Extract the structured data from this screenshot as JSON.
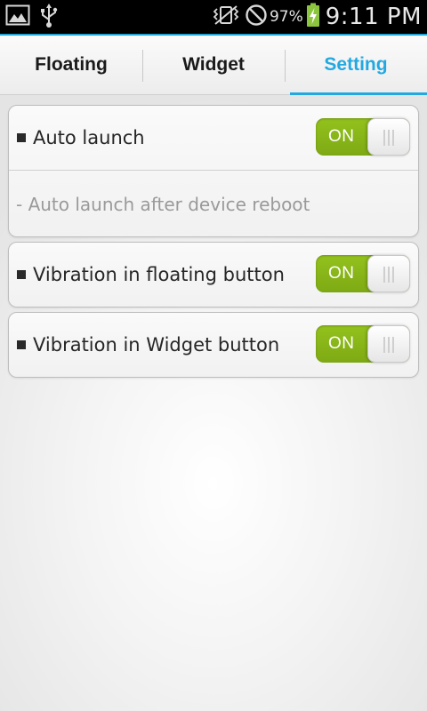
{
  "status_bar": {
    "left_icons": [
      "gallery-icon",
      "usb-icon"
    ],
    "right_icons": [
      "vibrate-icon",
      "blocked-icon",
      "battery-charging-icon"
    ],
    "battery_percent": "97%",
    "time": "9:11 PM"
  },
  "tabs": [
    {
      "label": "Floating",
      "active": false
    },
    {
      "label": "Widget",
      "active": false
    },
    {
      "label": "Setting",
      "active": true
    }
  ],
  "settings": {
    "auto_launch": {
      "label": "Auto launch",
      "description": "- Auto launch after device reboot",
      "toggle": "ON"
    },
    "vibration_floating": {
      "label": "Vibration in floating button",
      "toggle": "ON"
    },
    "vibration_widget": {
      "label": "Vibration in Widget button",
      "toggle": "ON"
    }
  },
  "colors": {
    "accent": "#23a9e0",
    "toggle_on": "#8cba1a",
    "status_bar": "#000000"
  }
}
